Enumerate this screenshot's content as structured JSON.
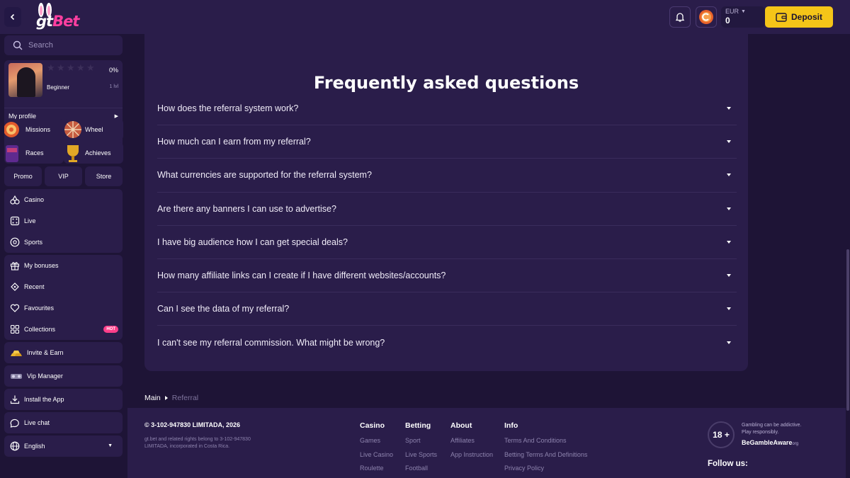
{
  "header": {
    "logo": {
      "part1": "gt",
      "part2": "Bet"
    },
    "wallet": {
      "currency": "EUR",
      "balance": "0"
    },
    "deposit_label": "Deposit"
  },
  "sidebar": {
    "search_placeholder": "Search",
    "profile": {
      "percent": "0%",
      "rank": "Beginner",
      "level": "1 lvl",
      "my_profile_label": "My profile",
      "stars_filled": 0,
      "stars_total": 5
    },
    "tiles": [
      {
        "label": "Missions"
      },
      {
        "label": "Wheel"
      },
      {
        "label": "Races"
      },
      {
        "label": "Achieves"
      }
    ],
    "small_buttons": [
      {
        "label": "Promo"
      },
      {
        "label": "VIP"
      },
      {
        "label": "Store"
      }
    ],
    "games_group": [
      {
        "label": "Casino",
        "icon": "casino-icon"
      },
      {
        "label": "Live",
        "icon": "dice-icon"
      },
      {
        "label": "Sports",
        "icon": "soccer-ball-icon"
      }
    ],
    "personal_group": [
      {
        "label": "My bonuses",
        "icon": "gift-icon"
      },
      {
        "label": "Recent",
        "icon": "history-icon"
      },
      {
        "label": "Favourites",
        "icon": "heart-icon"
      },
      {
        "label": "Collections",
        "icon": "grid-icon",
        "badge": "HOT"
      }
    ],
    "invite_label": "Invite & Earn",
    "vip_manager_label": "Vip Manager",
    "install_label": "Install the App",
    "live_chat_label": "Live chat",
    "language_label": "English"
  },
  "faq": {
    "title": "Frequently asked questions",
    "items": [
      {
        "question": "How does the referral system work?"
      },
      {
        "question": "How much can I earn from my referral?"
      },
      {
        "question": "What currencies are supported for the referral system?"
      },
      {
        "question": "Are there any banners I can use to advertise?"
      },
      {
        "question": "I have big audience how I can get special deals?"
      },
      {
        "question": "How many affiliate links can I create if I have different websites/accounts?"
      },
      {
        "question": "Can I see the data of my referral?"
      },
      {
        "question": "I can't see my referral commission. What might be wrong?"
      }
    ]
  },
  "breadcrumb": {
    "main": "Main",
    "current": "Referral"
  },
  "footer": {
    "copyright": "© 3-102-947830 LIMITADA, 2026",
    "legal": "gt.bet and related rights belong to 3-102-947830 LIMITADA, incorporated in Costa Rica.",
    "columns": [
      {
        "title": "Casino",
        "links": [
          "Games",
          "Live Casino",
          "Roulette"
        ]
      },
      {
        "title": "Betting",
        "links": [
          "Sport",
          "Live Sports",
          "Football"
        ]
      },
      {
        "title": "About",
        "links": [
          "Affiliates",
          "App Instruction"
        ]
      },
      {
        "title": "Info",
        "links": [
          "Terms And Conditions",
          "Betting Terms And Definitions",
          "Privacy Policy"
        ]
      }
    ],
    "age_badge": "18 +",
    "gamble_note_line1": "Gambling can be addictive.",
    "gamble_note_line2": "Play responsibly.",
    "gamble_aware": "BeGambleAware",
    "gamble_aware_org": "org",
    "follow_label": "Follow us:"
  },
  "colors": {
    "background": "#1e1436",
    "panel": "#2a1d4a",
    "accent_yellow": "#f5c518",
    "hot_pink": "#ff3f8a"
  }
}
